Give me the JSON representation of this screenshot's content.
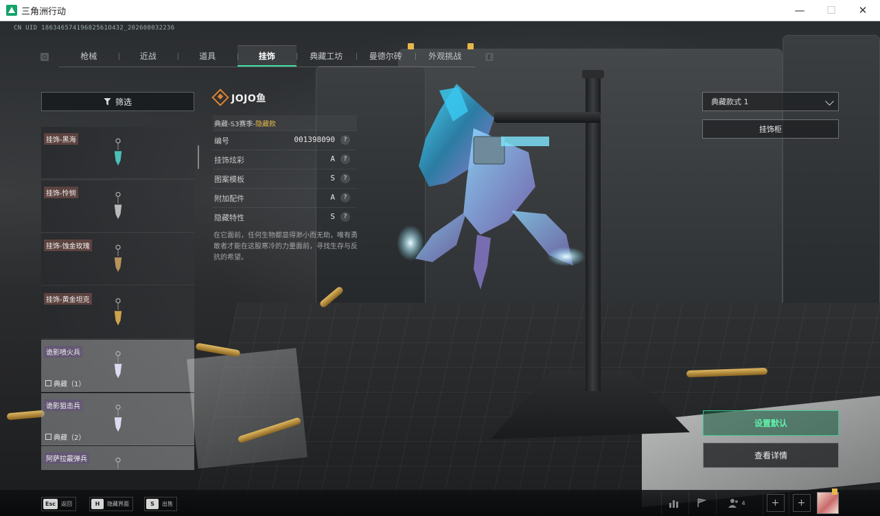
{
  "window": {
    "title": "三角洲行动"
  },
  "uid_text": "CN UID 18634657419682561O432_202608032236",
  "tabs": [
    {
      "label": "枪械",
      "active": false,
      "badge": false
    },
    {
      "label": "近战",
      "active": false,
      "badge": false
    },
    {
      "label": "道具",
      "active": false,
      "badge": false
    },
    {
      "label": "挂饰",
      "active": true,
      "badge": false
    },
    {
      "label": "典藏工坊",
      "active": false,
      "badge": false
    },
    {
      "label": "曼德尔砖",
      "active": false,
      "badge": true
    },
    {
      "label": "外观挑战",
      "active": false,
      "badge": true
    }
  ],
  "tab_keys": {
    "prev": "Q",
    "next": "E"
  },
  "filter": {
    "label": "筛选"
  },
  "list": {
    "items": [
      {
        "label": "挂饰-黑海",
        "sub": "",
        "special": false
      },
      {
        "label": "挂饰-怜悯",
        "sub": "",
        "special": false
      },
      {
        "label": "挂饰-蚀金玫瑰",
        "sub": "",
        "special": false
      },
      {
        "label": "挂饰-黄金坦克",
        "sub": "",
        "special": false
      },
      {
        "label": "诡影喷火兵",
        "sub": "典藏（1）",
        "special": true
      },
      {
        "label": "诡影狙击兵",
        "sub": "典藏（2）",
        "special": true
      },
      {
        "label": "阿萨拉霰弹兵",
        "sub": "",
        "special": true
      }
    ]
  },
  "detail": {
    "title": "JOJO鱼",
    "subtitle_prefix": "典藏-S3赛季-",
    "subtitle_highlight": "隐藏款",
    "attributes": [
      {
        "name": "编号",
        "value": "001398090"
      },
      {
        "name": "挂饰炫彩",
        "value": "A"
      },
      {
        "name": "图案模板",
        "value": "S"
      },
      {
        "name": "附加配件",
        "value": "A"
      },
      {
        "name": "隐藏特性",
        "value": "S"
      }
    ],
    "help_glyph": "?",
    "description": "在它面前，任何生物都显得渺小而无助，唯有勇敢者才能在这股寒冷的力量面前，寻找生存与反抗的希望。"
  },
  "right_panel": {
    "style_select": "典藏款式 1",
    "cabinet_button": "挂饰柜",
    "default_button": "设置默认",
    "details_button": "查看详情"
  },
  "bottom": {
    "hints": [
      {
        "key": "Esc",
        "label": "返回"
      },
      {
        "key": "H",
        "label": "隐藏界面"
      },
      {
        "key": "S",
        "label": "出售"
      }
    ],
    "friend_count": "4"
  },
  "colors": {
    "accent": "#3fe0a0",
    "highlight": "#e6b84a",
    "title_icon": "#e0822e"
  }
}
